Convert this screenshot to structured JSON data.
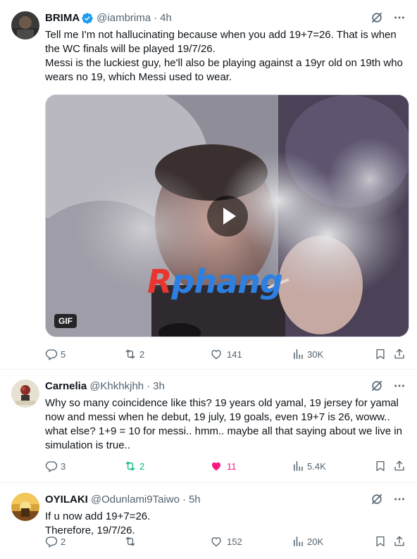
{
  "tweets": [
    {
      "name": "BRIMA",
      "verified": true,
      "handle": "@iambrima",
      "separator": "·",
      "time": "4h",
      "text": "Tell me I'm not hallucinating because when you add 19+7=26. That is when the WC finals will be played 19/7/26.\nMessi is the luckiest guy, he'll also be playing against a 19yr old on 19th who wears no 19, which Messi used to wear.",
      "media": {
        "type": "gif",
        "badge": "GIF",
        "watermark_left": "R",
        "watermark_right": "phang"
      },
      "stats": {
        "replies": "5",
        "reposts": "2",
        "likes": "141",
        "views": "30K"
      }
    },
    {
      "name": "Carnelia",
      "handle": "@Khkhkjhh",
      "separator": "·",
      "time": "3h",
      "text": "Why so many coincidence like this? 19 years old yamal, 19 jersey for yamal now and messi when he debut, 19 july, 19 goals, even 19+7 is 26, woww.. what else? 1+9 = 10 for messi..  hmm.. maybe all that saying about we live in simulation is true..",
      "stats": {
        "replies": "3",
        "reposts": "2",
        "likes": "11",
        "views": "5.4K"
      }
    },
    {
      "name": "OYILAKI",
      "handle": "@Odunlami9Taiwo",
      "separator": "·",
      "time": "5h",
      "text": "If u now add 19+7=26.\nTherefore, 19/7/26.",
      "stats": {
        "replies": "2",
        "reposts": "",
        "likes": "152",
        "views": "20K"
      }
    }
  ],
  "colors": {
    "text": "#0f1419",
    "secondary": "#536471",
    "verified": "#1d9bf0",
    "repost_active": "#00ba7c",
    "like_active": "#f91880",
    "border": "#eff3f4"
  },
  "icons": [
    "verified-badge-icon",
    "grok-icon",
    "more-icon",
    "reply-icon",
    "repost-icon",
    "like-icon",
    "views-icon",
    "bookmark-icon",
    "share-icon",
    "play-icon"
  ]
}
